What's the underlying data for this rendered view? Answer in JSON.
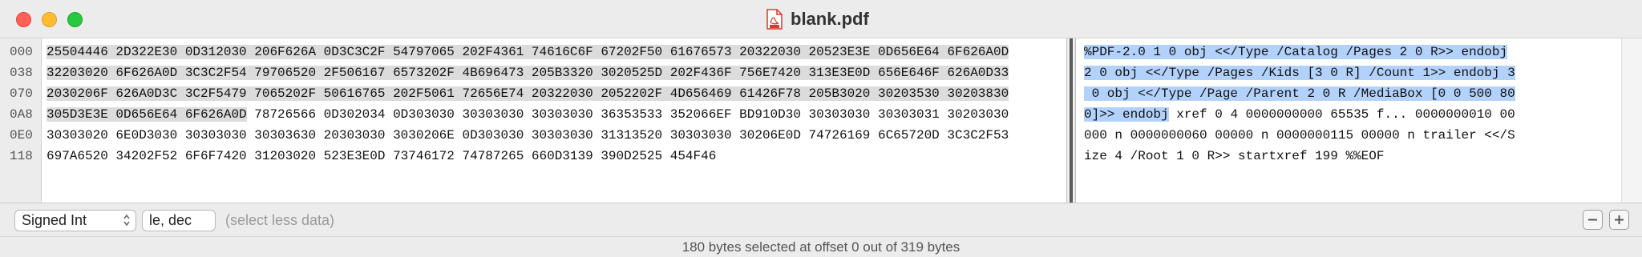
{
  "window": {
    "title": "blank.pdf",
    "file_icon": "pdf-file-icon"
  },
  "hex": {
    "offsets": [
      "000",
      "038",
      "070",
      "0A8",
      "0E0",
      "118"
    ],
    "rows": [
      [
        "25504446 2D322E30 0D312030 206F626A 0D3C3C2F 54797065 202F4361 74616C6F 67202F50 61676573 20322030 20523E3E 0D656E64 6F626A0D",
        ""
      ],
      [
        "32203020 6F626A0D 3C3C2F54 79706520 2F506167 6573202F 4B696473 205B3320 3020525D 202F436F 756E7420 313E3E0D 656E646F 626A0D33",
        ""
      ],
      [
        "2030206F 626A0D3C 3C2F5479 7065202F 50616765 202F5061 72656E74 20322030 2052202F 4D656469 61426F78 205B3020 30203530 30203830",
        ""
      ],
      [
        "305D3E3E 0D656E64 6F626A0D",
        " 78726566 0D302034 0D303030 30303030 30303030 36353533 352066EF BD910D30 30303030 30303031 30203030"
      ],
      [
        "",
        "30303020 6E0D3030 30303030 30303630 20303030 3030206E 0D303030 30303030 31313520 30303030 30206E0D 74726169 6C65720D 3C3C2F53"
      ],
      [
        "",
        "697A6520 34202F52 6F6F7420 31203020 523E3E0D 73746172 74787265 660D3139 390D2525 454F46"
      ]
    ]
  },
  "ascii": {
    "rows": [
      [
        "%PDF-2.0 1 0 obj <</Type /Catalog /Pages 2 0 R>> endobj",
        ""
      ],
      [
        "2 0 obj <</Type /Pages /Kids [3 0 R] /Count 1>> endobj 3",
        ""
      ],
      [
        " 0 obj <</Type /Page /Parent 2 0 R /MediaBox [0 0 500 80",
        ""
      ],
      [
        "0]>> endobj",
        " xref 0 4 0000000000 65535 f... 0000000010 00"
      ],
      [
        "",
        "000 n 0000000060 00000 n 0000000115 00000 n trailer <</S"
      ],
      [
        "",
        "ize 4 /Root 1 0 R>> startxref 199 %%EOF"
      ]
    ]
  },
  "toolbar": {
    "type_select": "Signed Int",
    "endian_select": "le, dec",
    "hint": "(select less data)",
    "remove_button": "minus-icon",
    "add_button": "plus-icon"
  },
  "status": {
    "text": "180 bytes selected at offset 0 out of 319 bytes"
  }
}
